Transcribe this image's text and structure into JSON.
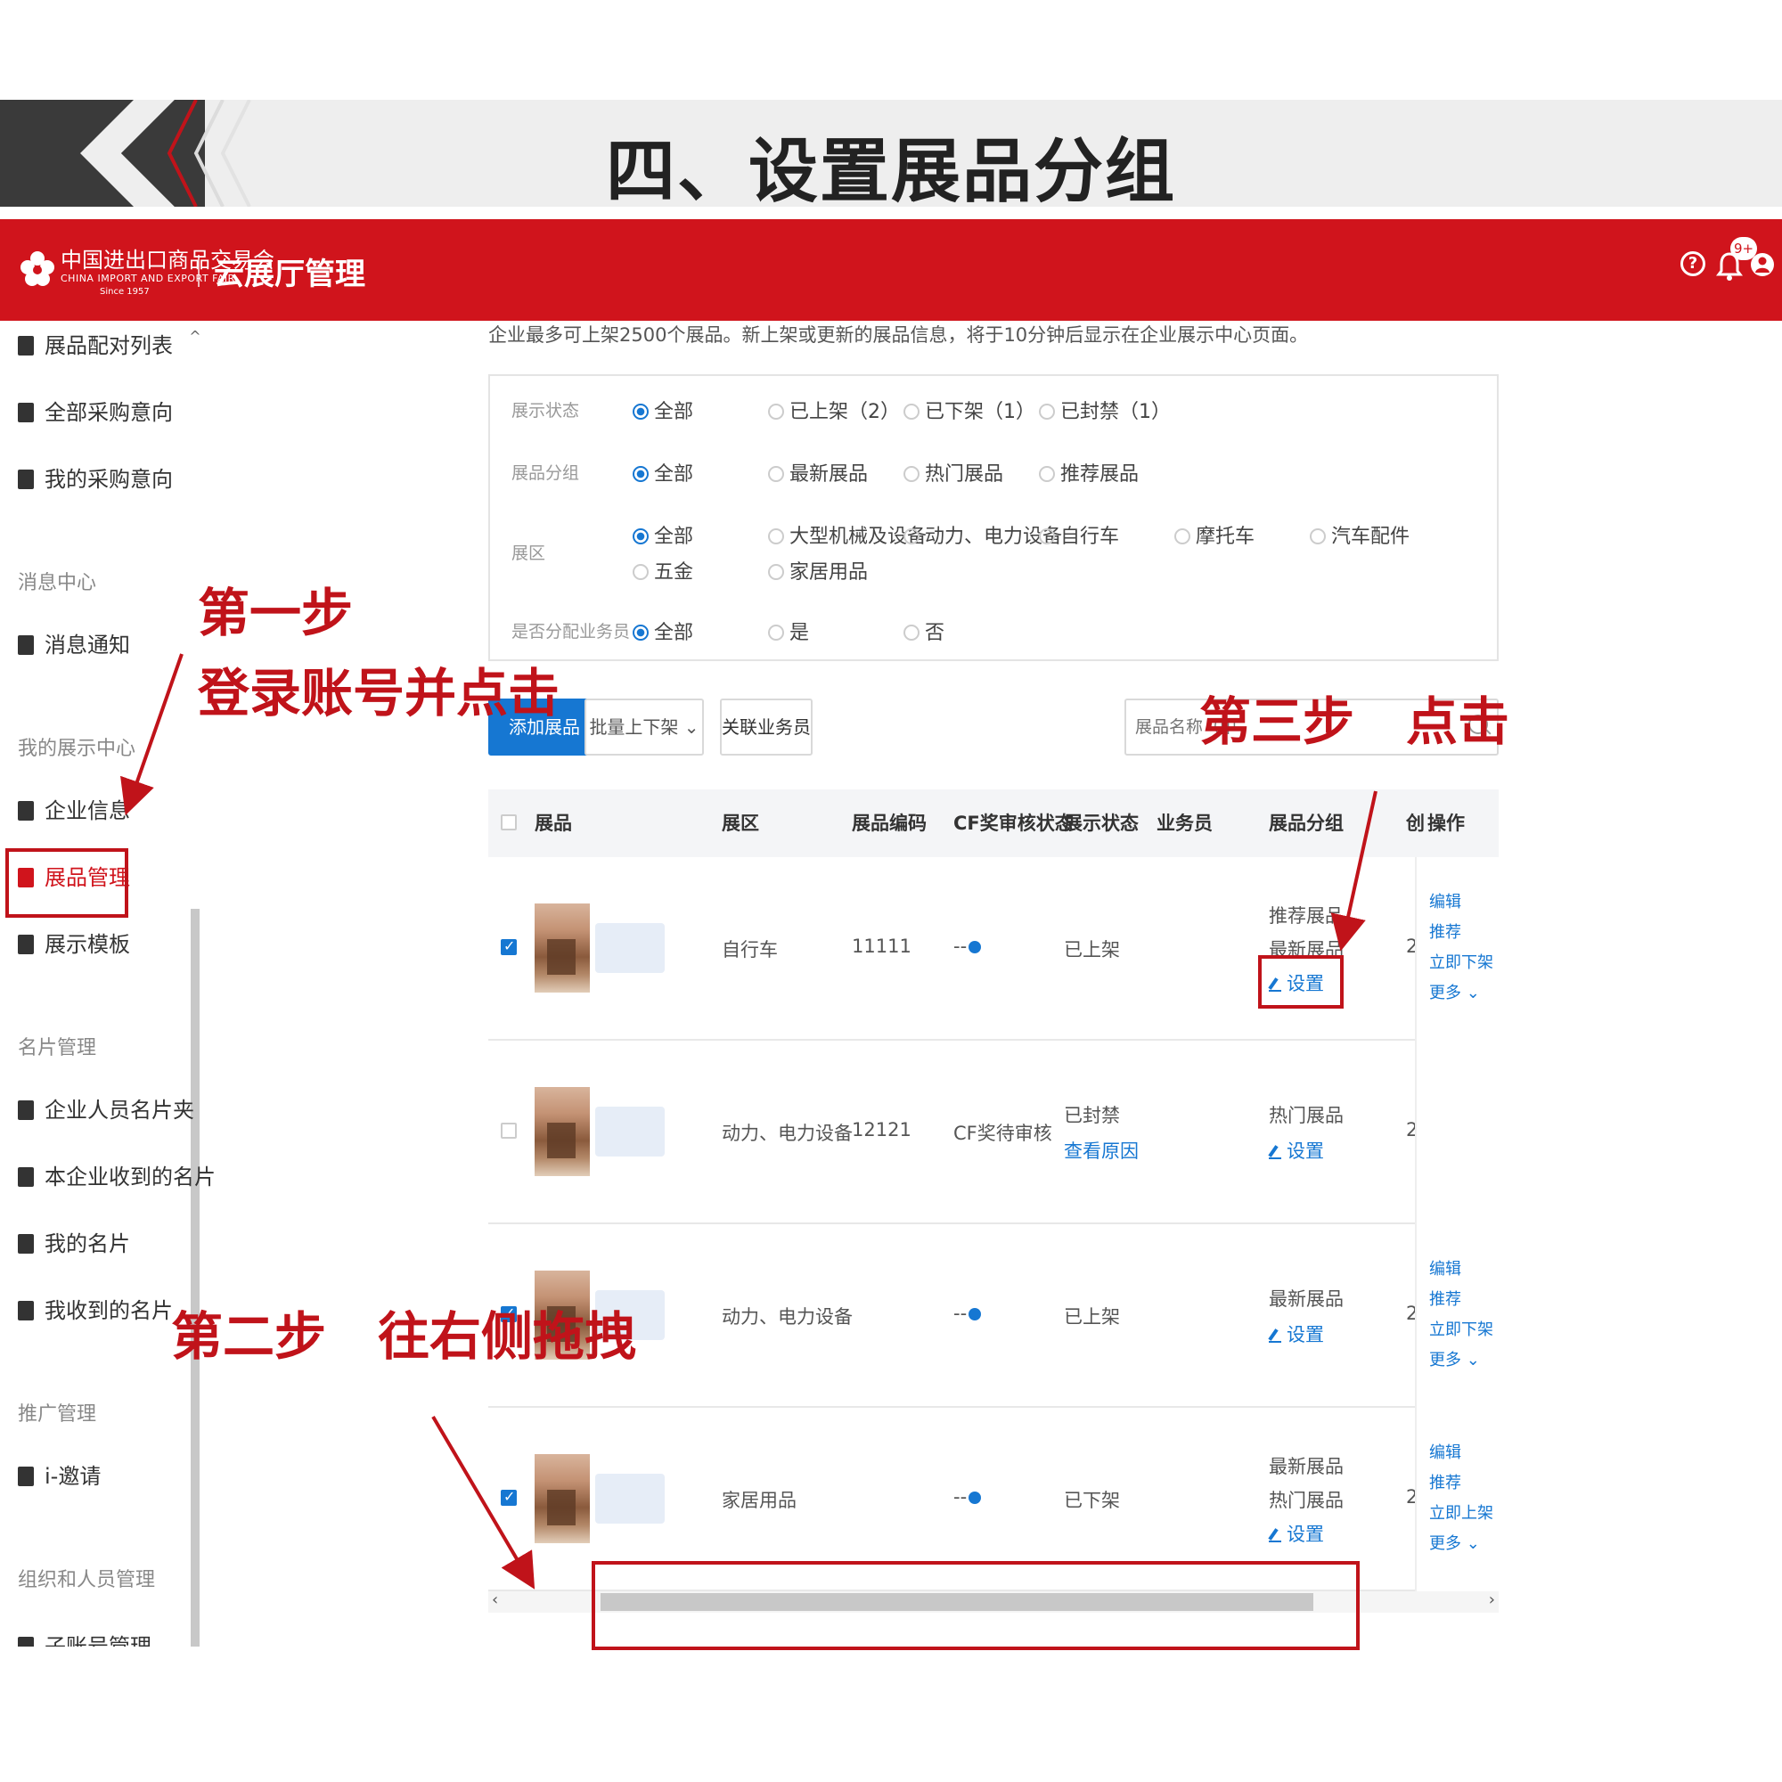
{
  "slide_title": "四、设置展品分组",
  "topbar": {
    "logo_cn": "中国进出口商品交易会",
    "logo_en": "CHINA IMPORT AND EXPORT FAIR",
    "logo_since": "Since 1957",
    "app_title": "云展厅管理",
    "help_icon": "?",
    "bell_badge": "9+"
  },
  "sidebar": {
    "items": [
      {
        "label": "展品配对列表"
      },
      {
        "label": "全部采购意向"
      },
      {
        "label": "我的采购意向"
      },
      {
        "section": "消息中心"
      },
      {
        "label": "消息通知"
      },
      {
        "section": "我的展示中心"
      },
      {
        "label": "企业信息"
      },
      {
        "label": "展品管理"
      },
      {
        "label": "展示模板"
      },
      {
        "section": "名片管理"
      },
      {
        "label": "企业人员名片夹"
      },
      {
        "label": "本企业收到的名片"
      },
      {
        "label": "我的名片"
      },
      {
        "label": "我收到的名片"
      },
      {
        "section": "推广管理"
      },
      {
        "label": "i-邀请"
      },
      {
        "section": "组织和人员管理"
      },
      {
        "label": "子账号管理"
      }
    ],
    "scroll_up": "^"
  },
  "notice": "企业最多可上架2500个展品。新上架或更新的展品信息，将于10分钟后显示在企业展示中心页面。",
  "filters": {
    "status_label": "展示状态",
    "status_opts": [
      "全部",
      "已上架（2）",
      "已下架（1）",
      "已封禁（1）"
    ],
    "group_label": "展品分组",
    "group_opts": [
      "全部",
      "最新展品",
      "热门展品",
      "推荐展品"
    ],
    "zone_label": "展区",
    "zone_opts": [
      "全部",
      "大型机械及设备",
      "动力、电力设备",
      "自行车",
      "摩托车",
      "汽车配件",
      "五金",
      "家居用品"
    ],
    "assign_label": "是否分配业务员",
    "assign_opts": [
      "全部",
      "是",
      "否"
    ]
  },
  "toolbar": {
    "add": "添加展品",
    "batch": "批量上下架",
    "assoc": "关联业务员",
    "search_placeholder": "展品名称（中"
  },
  "table": {
    "headers": [
      "展品",
      "展区",
      "展品编码",
      "CF奖审核状态",
      "展示状态",
      "业务员",
      "展品分组",
      "创",
      "操作"
    ],
    "rows": [
      {
        "zone": "自行车",
        "code": "11111",
        "cf": "--",
        "status": "已上架",
        "status_link": "",
        "groups": [
          "推荐展品",
          "最新展品"
        ],
        "set": "设置",
        "create": "2",
        "ops": [
          "编辑",
          "推荐",
          "立即下架",
          "更多"
        ]
      },
      {
        "zone": "动力、电力设备",
        "code": "12121",
        "cf": "CF奖待审核",
        "status": "已封禁",
        "status_link": "查看原因",
        "groups": [
          "热门展品"
        ],
        "set": "设置",
        "create": "2",
        "ops": []
      },
      {
        "zone": "动力、电力设备",
        "code": "",
        "cf": "--",
        "status": "已上架",
        "status_link": "",
        "groups": [
          "最新展品"
        ],
        "set": "设置",
        "create": "2",
        "ops": [
          "编辑",
          "推荐",
          "立即下架",
          "更多"
        ]
      },
      {
        "zone": "家居用品",
        "code": "",
        "cf": "--",
        "status": "已下架",
        "status_link": "",
        "groups": [
          "最新展品",
          "热门展品"
        ],
        "set": "设置",
        "create": "2",
        "ops": [
          "编辑",
          "推荐",
          "立即上架",
          "更多"
        ]
      }
    ]
  },
  "annotations": {
    "step1_line1": "第一步",
    "step1_line2": "登录账号并点击",
    "step2": "第二步　往右侧拖拽",
    "step3": "第三步　点击"
  },
  "colors": {
    "brand_red": "#d0141c",
    "accent_blue": "#1677d2",
    "annotation_red": "#c0131a"
  }
}
